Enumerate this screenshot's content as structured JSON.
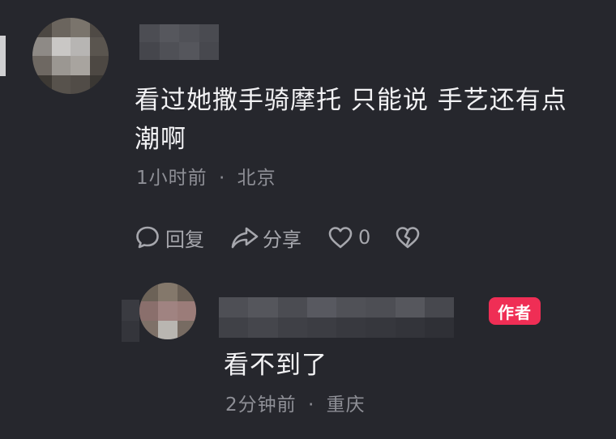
{
  "comment": {
    "text_line1": "看过她撒手骑摩托 只能说 手艺还有点",
    "text_line2": "潮啊",
    "time": "1小时前",
    "separator": "·",
    "location": "北京",
    "reply_label": "回复",
    "share_label": "分享",
    "like_count": "0"
  },
  "reply": {
    "author_badge": "作者",
    "text": "看不到了",
    "time": "2分钟前",
    "separator": "·",
    "location": "重庆"
  },
  "colors": {
    "background": "#26272d",
    "badge": "#ef2e55",
    "meta_text": "#8e8f96"
  },
  "icons": [
    "comment-bubble-icon",
    "share-arrow-icon",
    "heart-icon",
    "broken-heart-icon"
  ]
}
